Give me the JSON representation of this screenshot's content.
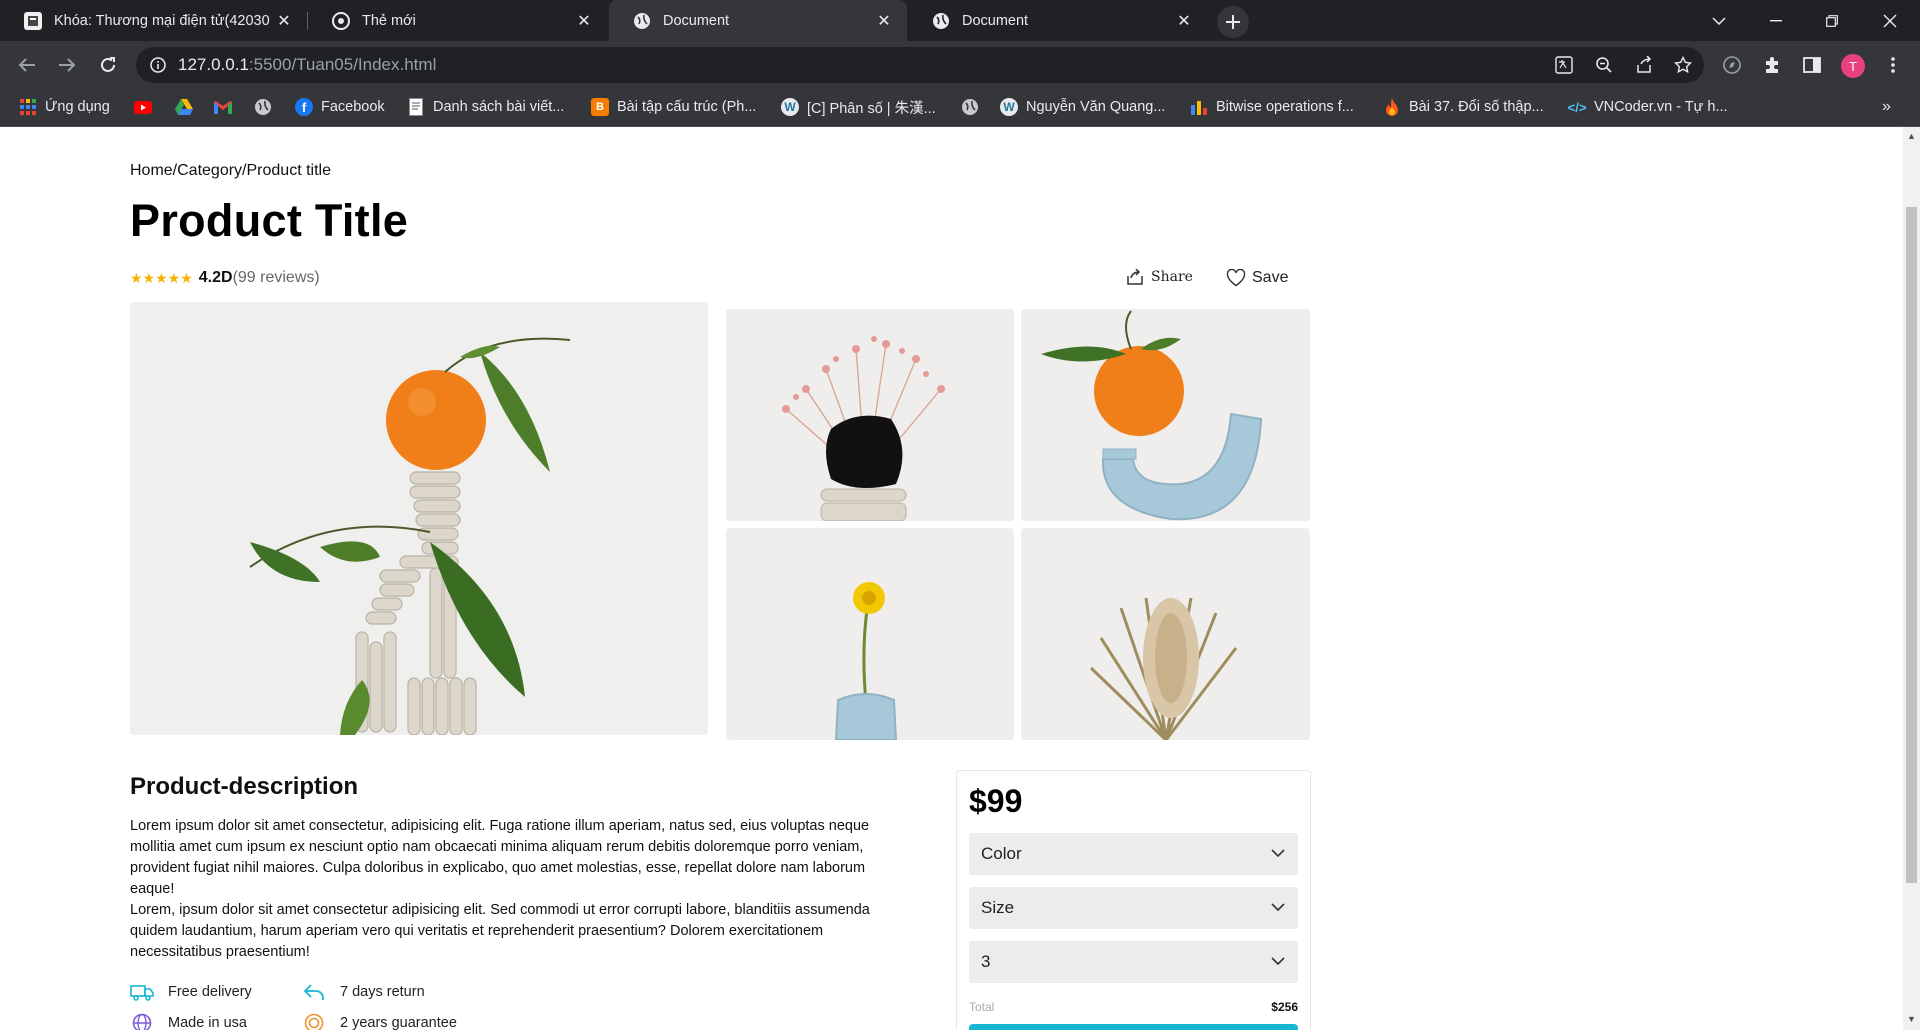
{
  "browser": {
    "tabs": [
      {
        "title": "Khóa: Thương mại điện tử(42030",
        "icon": "moodle-icon",
        "active": false
      },
      {
        "title": "Thẻ mới",
        "icon": "chrome-icon",
        "active": false
      },
      {
        "title": "Document",
        "icon": "globe-icon",
        "active": true
      },
      {
        "title": "Document",
        "icon": "globe-icon",
        "active": false
      }
    ],
    "tab_close_glyph": "✕",
    "url_host": "127.0.0.1",
    "url_path": ":5500/Tuan05/Index.html",
    "profile_initial": "T",
    "bookmarks": [
      {
        "label": "Ứng dụng",
        "icon": "apps-grid-icon"
      },
      {
        "label": "",
        "icon": "youtube-icon"
      },
      {
        "label": "",
        "icon": "google-drive-icon"
      },
      {
        "label": "",
        "icon": "gmail-icon"
      },
      {
        "label": "",
        "icon": "globe-icon"
      },
      {
        "label": "Facebook",
        "icon": "facebook-icon"
      },
      {
        "label": "Danh sách bài viết...",
        "icon": "document-icon"
      },
      {
        "label": "Bài tập cấu trúc (Ph...",
        "icon": "blogger-icon"
      },
      {
        "label": "[C] Phân số | 朱漢...",
        "icon": "wordpress-icon"
      },
      {
        "label": "",
        "icon": "globe-icon"
      },
      {
        "label": "Nguyễn Văn Quang...",
        "icon": "wordpress-icon"
      },
      {
        "label": "Bitwise operations f...",
        "icon": "bar-chart-icon"
      },
      {
        "label": "Bài 37. Đổi số thập...",
        "icon": "fire-icon"
      },
      {
        "label": "VNCoder.vn - Tự h...",
        "icon": "code-icon"
      }
    ],
    "bookmarks_overflow": "»"
  },
  "page": {
    "breadcrumb": "Home/Category/Product title",
    "title": "Product Title",
    "rating": {
      "stars_glyph": "★★★★★",
      "score": "4.2D",
      "reviews": "(99 reviews)",
      "value_out_of_5": 4.2
    },
    "share_label": "Share",
    "save_label": "Save",
    "description_title": "Product-description",
    "description_p1": "Lorem ipsum dolor sit amet consectetur, adipisicing elit. Fuga ratione illum aperiam, natus sed, eius voluptas neque mollitia amet cum ipsum ex nesciunt optio nam obcaecati minima aliquam rerum debitis doloremque porro veniam, provident fugiat nihil maiores. Culpa doloribus in explicabo, quo amet molestias, esse, repellat dolore nam laborum eaque!",
    "description_p2": "Lorem, ipsum dolor sit amet consectetur adipisicing elit. Sed commodi ut error corrupti labore, blanditiis assumenda quidem laudantium, harum aperiam vero qui veritatis et reprehenderit praesentium? Dolorem exercitationem necessitatibus praesentium!",
    "features": [
      {
        "label": "Free delivery",
        "icon": "truck-icon"
      },
      {
        "label": "7 days return",
        "icon": "return-arrow-icon"
      },
      {
        "label": "Made in usa",
        "icon": "globe-icon"
      },
      {
        "label": "2 years guarantee",
        "icon": "badge-icon"
      }
    ],
    "buy": {
      "price": "$99",
      "color_select": "Color",
      "size_select": "Size",
      "quantity_select": "3",
      "total_label": "Total",
      "total_value": "$256"
    }
  },
  "colors": {
    "accent": "#16b6d2",
    "star": "#f5b301",
    "chrome_dark": "#202124",
    "chrome_toolbar": "#35363a"
  }
}
